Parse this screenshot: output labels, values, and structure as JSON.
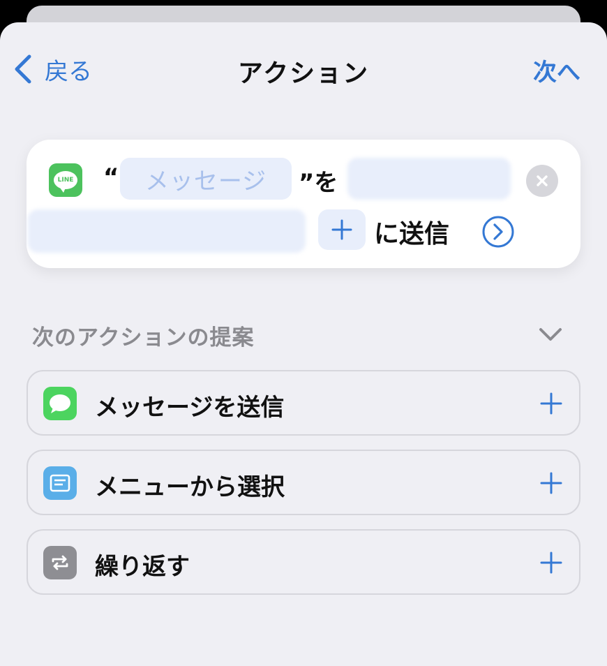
{
  "nav": {
    "back_label": "戻る",
    "title": "アクション",
    "next_label": "次へ"
  },
  "action_card": {
    "app_icon": "line-icon",
    "app_icon_text": "LINE",
    "quote_open": "“",
    "message_placeholder": "メッセージ",
    "quote_close": "”を",
    "send_label": "に送信",
    "clear_icon": "close-icon",
    "add_icon": "plus-icon",
    "expand_icon": "chevron-right-circle-icon"
  },
  "suggestions": {
    "header": "次のアクションの提案",
    "collapse_icon": "chevron-down-icon",
    "items": [
      {
        "label": "メッセージを送信",
        "icon": "messages-icon",
        "icon_color": "#4cd45f",
        "add_icon": "plus-icon"
      },
      {
        "label": "メニューから選択",
        "icon": "menu-icon",
        "icon_color": "#5aaee8",
        "add_icon": "plus-icon"
      },
      {
        "label": "繰り返す",
        "icon": "repeat-icon",
        "icon_color": "#8e8e93",
        "add_icon": "plus-icon"
      }
    ]
  },
  "colors": {
    "accent": "#3478d4",
    "background": "#efeff4",
    "token_bg": "#e8eefb",
    "token_text": "#a8c0ec"
  }
}
